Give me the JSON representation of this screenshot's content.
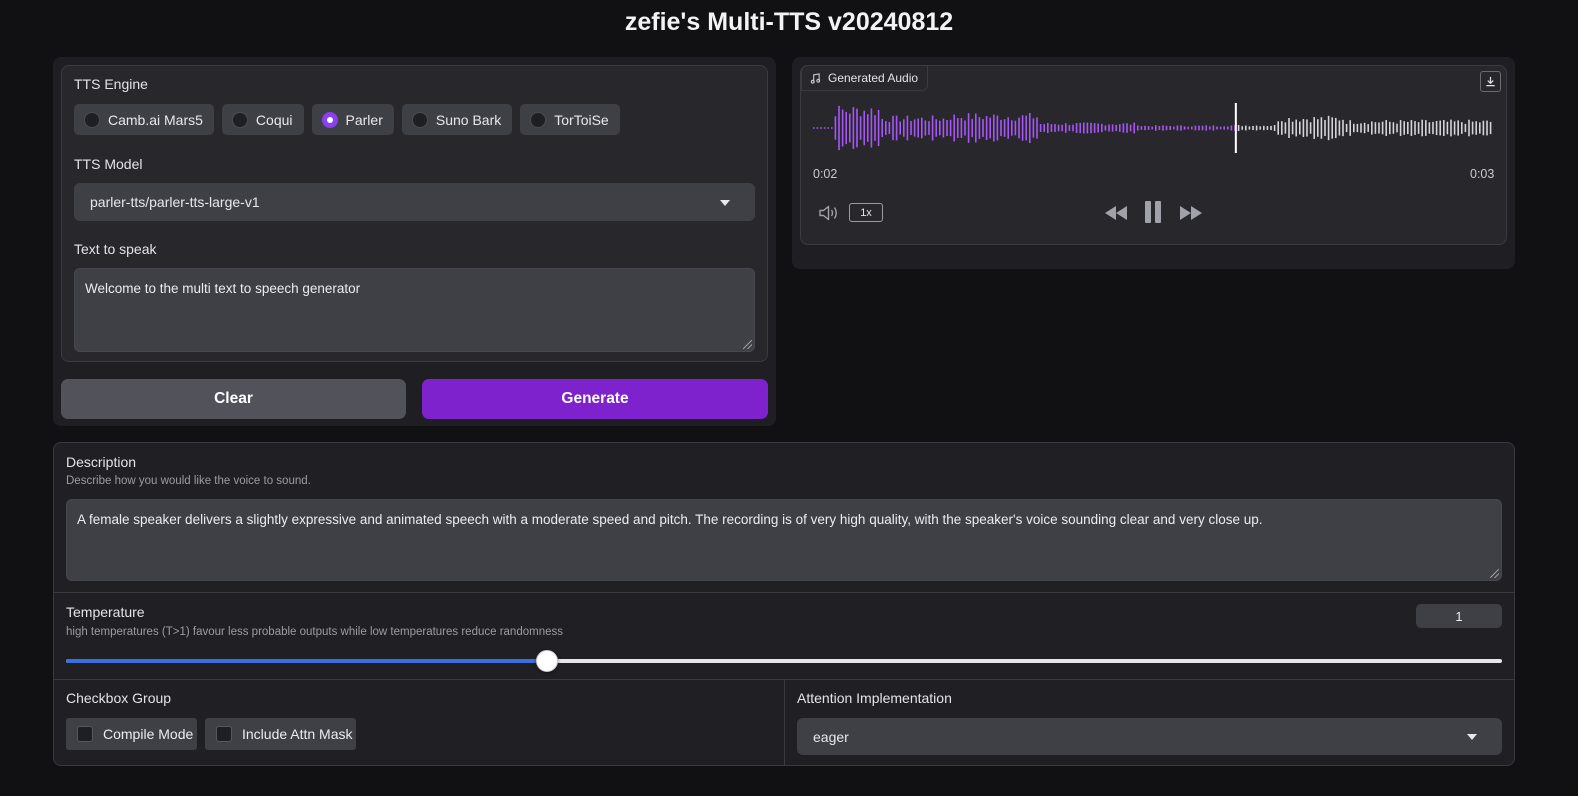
{
  "app": {
    "title": "zefie's Multi-TTS v20240812"
  },
  "engine": {
    "label": "TTS Engine",
    "options": [
      "Camb.ai Mars5",
      "Coqui",
      "Parler",
      "Suno Bark",
      "TorToiSe"
    ],
    "selected": "Parler"
  },
  "model": {
    "label": "TTS Model",
    "value": "parler-tts/parler-tts-large-v1"
  },
  "text": {
    "label": "Text to speak",
    "value": "Welcome to the multi text to speech generator"
  },
  "buttons": {
    "clear": "Clear",
    "generate": "Generate"
  },
  "audio": {
    "label": "Generated Audio",
    "current_time": "0:02",
    "duration": "0:03",
    "playback_speed": "1x",
    "progress": 0.62,
    "icons": [
      "music-note-icon",
      "download-icon",
      "volume-icon",
      "rewind-icon",
      "pause-icon",
      "fast-forward-icon"
    ]
  },
  "description": {
    "label": "Description",
    "info": "Describe how you would like the voice to sound.",
    "value": "A female speaker delivers a slightly expressive and animated speech with a moderate speed and pitch. The recording is of very high quality, with the speaker's voice sounding clear and very close up."
  },
  "temperature": {
    "label": "Temperature",
    "info": "high temperatures (T>1) favour less probable outputs while low temperatures reduce randomness",
    "value": "1",
    "fraction": 0.335
  },
  "checkbox_group": {
    "label": "Checkbox Group",
    "options": [
      "Compile Mode",
      "Include Attn Mask"
    ]
  },
  "attention": {
    "label": "Attention Implementation",
    "value": "eager"
  },
  "colors": {
    "accent": "#7e22ce",
    "waveform_played": "#a855f7",
    "waveform_unplayed": "#d4d4d8",
    "slider_fill": "#3b6fe0"
  }
}
